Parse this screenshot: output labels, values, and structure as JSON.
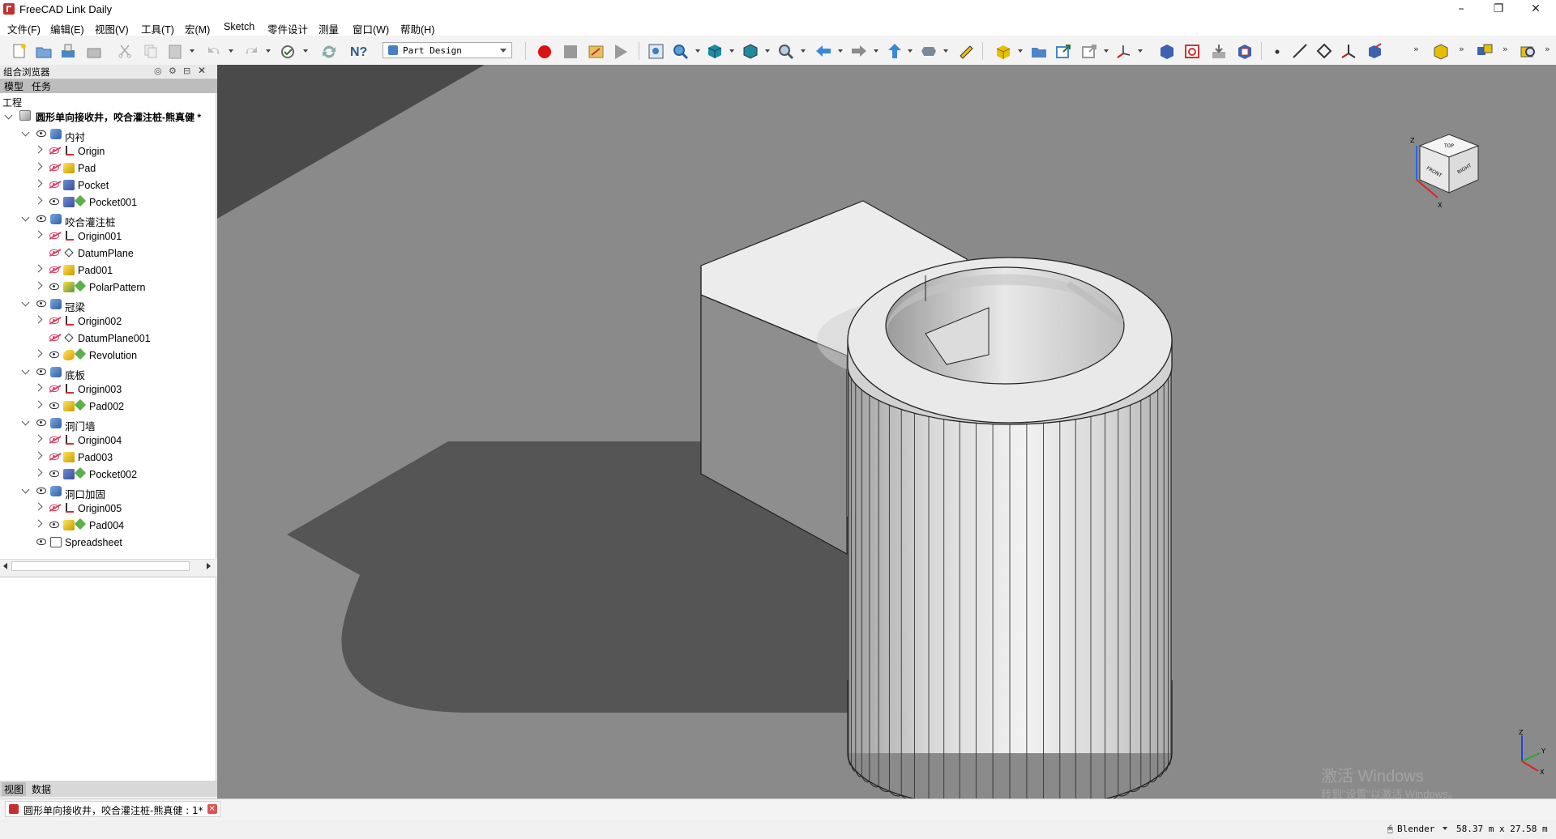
{
  "window": {
    "title": "FreeCAD Link Daily",
    "controls": [
      "–",
      "❐",
      "✕"
    ]
  },
  "menu": [
    "文件(F)",
    "编辑(E)",
    "视图(V)",
    "工具(T)",
    "宏(M)",
    "Sketch",
    "零件设计",
    "测量",
    "窗口(W)",
    "帮助(H)"
  ],
  "toolbar": {
    "workbench": "Part Design"
  },
  "combo_view": {
    "title": "组合浏览器",
    "tabs": [
      "模型",
      "任务"
    ],
    "section_label": "工程",
    "document": "圆形单向接收井，咬合灌注桩-熊真健 *",
    "bottom_tabs": [
      "视图",
      "数据"
    ]
  },
  "tree": [
    {
      "label": "内衬",
      "level": 1,
      "expanded": true,
      "visible": true,
      "icon": "body"
    },
    {
      "label": "Origin",
      "level": 2,
      "visible": false,
      "icon": "origin"
    },
    {
      "label": "Pad",
      "level": 2,
      "visible": false,
      "icon": "pad"
    },
    {
      "label": "Pocket",
      "level": 2,
      "visible": false,
      "icon": "pocket"
    },
    {
      "label": "Pocket001",
      "level": 2,
      "visible": true,
      "icon": "pocket",
      "tip": true
    },
    {
      "label": "咬合灌注桩",
      "level": 1,
      "expanded": true,
      "visible": true,
      "icon": "body"
    },
    {
      "label": "Origin001",
      "level": 2,
      "visible": false,
      "icon": "origin"
    },
    {
      "label": "DatumPlane",
      "level": 2,
      "visible": false,
      "icon": "plane",
      "no_chevron": true
    },
    {
      "label": "Pad001",
      "level": 2,
      "visible": false,
      "icon": "pad"
    },
    {
      "label": "PolarPattern",
      "level": 2,
      "visible": true,
      "icon": "pattern",
      "tip": true
    },
    {
      "label": "冠梁",
      "level": 1,
      "expanded": true,
      "visible": true,
      "icon": "body"
    },
    {
      "label": "Origin002",
      "level": 2,
      "visible": false,
      "icon": "origin"
    },
    {
      "label": "DatumPlane001",
      "level": 2,
      "visible": false,
      "icon": "plane",
      "no_chevron": true
    },
    {
      "label": "Revolution",
      "level": 2,
      "visible": true,
      "icon": "rev",
      "tip": true
    },
    {
      "label": "底板",
      "level": 1,
      "expanded": true,
      "visible": true,
      "icon": "body"
    },
    {
      "label": "Origin003",
      "level": 2,
      "visible": false,
      "icon": "origin"
    },
    {
      "label": "Pad002",
      "level": 2,
      "visible": true,
      "icon": "pad",
      "tip": true
    },
    {
      "label": "洞门墙",
      "level": 1,
      "expanded": true,
      "visible": true,
      "icon": "body"
    },
    {
      "label": "Origin004",
      "level": 2,
      "visible": false,
      "icon": "origin"
    },
    {
      "label": "Pad003",
      "level": 2,
      "visible": false,
      "icon": "pad"
    },
    {
      "label": "Pocket002",
      "level": 2,
      "visible": true,
      "icon": "pocket",
      "tip": true
    },
    {
      "label": "洞口加固",
      "level": 1,
      "expanded": true,
      "visible": true,
      "icon": "body"
    },
    {
      "label": "Origin005",
      "level": 2,
      "visible": false,
      "icon": "origin"
    },
    {
      "label": "Pad004",
      "level": 2,
      "visible": true,
      "icon": "pad",
      "tip": true
    },
    {
      "label": "Spreadsheet",
      "level": 1,
      "visible": true,
      "icon": "sheet",
      "no_chevron": true
    }
  ],
  "navcube": {
    "faces": [
      "TOP",
      "FRONT",
      "RIGHT"
    ],
    "axes": [
      "Z",
      "X"
    ]
  },
  "axis_triad": [
    "Z",
    "Y",
    "X"
  ],
  "watermark": {
    "line1": "激活 Windows",
    "line2": "转到\"设置\"以激活 Windows。"
  },
  "doc_tab": {
    "label": "圆形单向接收井，咬合灌注桩-熊真健 : 1*",
    "close": "×"
  },
  "statusbar": {
    "nav_style": "Blender",
    "dimensions": "58.37 m x 27.58 m"
  },
  "colors": {
    "viewport_bg": "#8a8a8a",
    "shadow": "#555555",
    "model_face": "#e8e8e8"
  }
}
